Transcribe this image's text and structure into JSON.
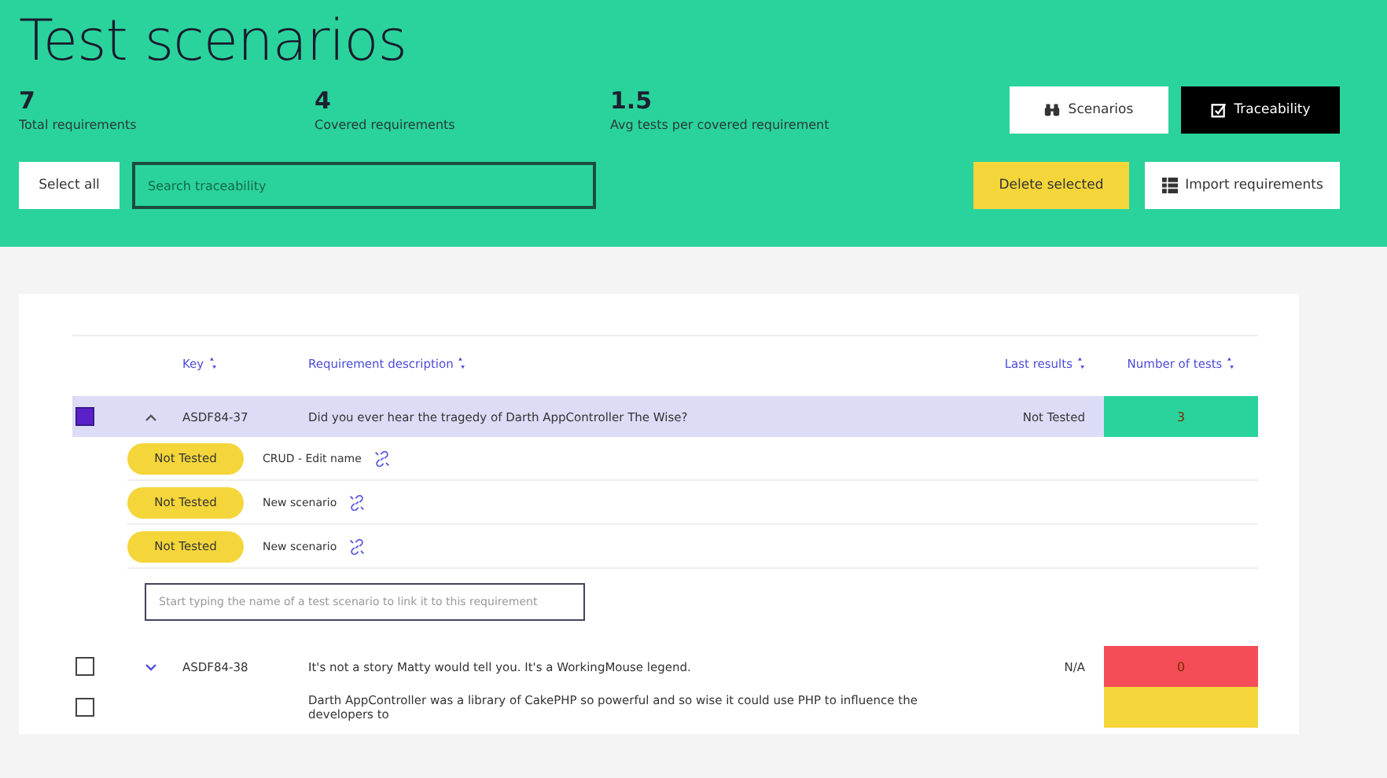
{
  "title": "Test scenarios",
  "stats": [
    {
      "value": "7",
      "label": "Total requirements"
    },
    {
      "value": "4",
      "label": "Covered requirements"
    },
    {
      "value": "1.5",
      "label": "Avg tests per covered requirement"
    }
  ],
  "view_tabs": [
    {
      "label": "Scenarios",
      "selected": false
    },
    {
      "label": "Traceability",
      "selected": true
    }
  ],
  "select_all": "Select all",
  "search": {
    "placeholder": "Search traceability"
  },
  "delete_button": "Delete selected",
  "import_button": "Import requirements",
  "columns": [
    "Key",
    "Requirement description",
    "Last results",
    "Number of tests"
  ],
  "requirements": [
    {
      "selected": true,
      "expanded": true,
      "key": "ASDF84-37",
      "description": "Did you ever hear the tragedy of Darth AppController The Wise?",
      "last_result": "Not Tested",
      "tests": "3",
      "color": "#2ad39b",
      "scenarios": [
        {
          "status": "Not Tested",
          "name": "CRUD - Edit name"
        },
        {
          "status": "Not Tested",
          "name": "New scenario"
        },
        {
          "status": "Not Tested",
          "name": "New scenario"
        }
      ],
      "link_placeholder": "Start typing the name of a test scenario to link it to this requirement"
    },
    {
      "selected": false,
      "expanded": false,
      "key": "ASDF84-38",
      "description": "It's not a story Matty would tell you. It's a WorkingMouse legend.",
      "last_result": "N/A",
      "tests": "0",
      "color": "#f44d57"
    },
    {
      "selected": false,
      "description": "Darth AppController was a library of CakePHP so powerful and so wise it could use PHP to influence the developers to",
      "color": "#f5d63a"
    }
  ]
}
